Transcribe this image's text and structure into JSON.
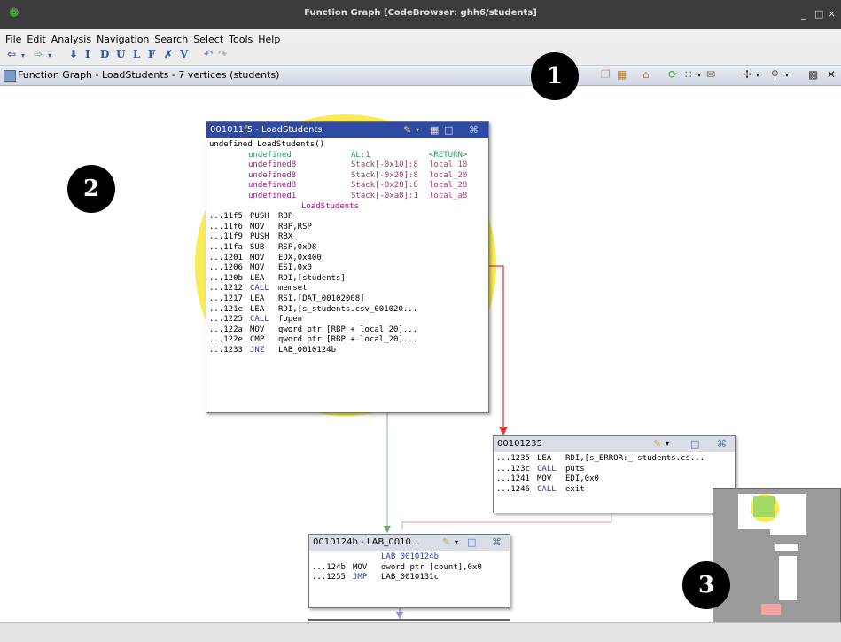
{
  "window": {
    "title": "Function Graph [CodeBrowser: ghh6/students]",
    "minimize": "_",
    "maximize": "□",
    "close": "×"
  },
  "menu": [
    "File",
    "Edit",
    "Analysis",
    "Navigation",
    "Search",
    "Select",
    "Tools",
    "Help"
  ],
  "toolbar_letters": [
    "I",
    "D",
    "U",
    "L",
    "F",
    "V"
  ],
  "provider": {
    "title": "Function Graph - LoadStudents - 7 vertices  (students)"
  },
  "callouts": [
    "1",
    "2",
    "3"
  ],
  "blocks": {
    "load": {
      "header": "001011f5 - LoadStudents",
      "sig": "undefined LoadStudents()",
      "params": [
        {
          "type": "undefined",
          "loc": "AL:1",
          "name": "<RETURN>"
        },
        {
          "type": "undefined8",
          "loc": "Stack[-0x10]:8",
          "name": "local_10"
        },
        {
          "type": "undefined8",
          "loc": "Stack[-0x20]:8",
          "name": "local_20"
        },
        {
          "type": "undefined8",
          "loc": "Stack[-0x28]:8",
          "name": "local_28"
        },
        {
          "type": "undefined1",
          "loc": "Stack[-0xa8]:1",
          "name": "local_a8"
        }
      ],
      "label": "LoadStudents",
      "instr": [
        {
          "addr": "...11f5",
          "op": "PUSH",
          "a": "RBP"
        },
        {
          "addr": "...11f6",
          "op": "MOV",
          "a": "RBP,RSP"
        },
        {
          "addr": "...11f9",
          "op": "PUSH",
          "a": "RBX"
        },
        {
          "addr": "...11fa",
          "op": "SUB",
          "a": "RSP,0x98"
        },
        {
          "addr": "...1201",
          "op": "MOV",
          "a": "EDX,0x400"
        },
        {
          "addr": "...1206",
          "op": "MOV",
          "a": "ESI,0x0"
        },
        {
          "addr": "...120b",
          "op": "LEA",
          "a": "RDI,[students]"
        },
        {
          "addr": "...1212",
          "op": "CALL",
          "a": "memset"
        },
        {
          "addr": "...1217",
          "op": "LEA",
          "a": "RSI,[DAT_00102008]"
        },
        {
          "addr": "...121e",
          "op": "LEA",
          "a": "RDI,[s_students.csv_001020..."
        },
        {
          "addr": "...1225",
          "op": "CALL",
          "a": "fopen"
        },
        {
          "addr": "...122a",
          "op": "MOV",
          "a": "qword ptr [RBP + local_20]..."
        },
        {
          "addr": "...122e",
          "op": "CMP",
          "a": "qword ptr [RBP + local_20]..."
        },
        {
          "addr": "...1233",
          "op": "JNZ",
          "a": "LAB_0010124b"
        }
      ]
    },
    "b235": {
      "header": "00101235",
      "instr": [
        {
          "addr": "...1235",
          "op": "LEA",
          "a": "RDI,[s_ERROR:_'students.cs..."
        },
        {
          "addr": "...123c",
          "op": "CALL",
          "a": "puts"
        },
        {
          "addr": "...1241",
          "op": "MOV",
          "a": "EDI,0x0"
        },
        {
          "addr": "...1246",
          "op": "CALL",
          "a": "exit"
        }
      ]
    },
    "b24b": {
      "header": "0010124b - LAB_0010...",
      "label": "LAB_0010124b",
      "instr": [
        {
          "addr": "...124b",
          "op": "MOV",
          "a": "dword ptr [count],0x0"
        },
        {
          "addr": "...1255",
          "op": "JMP",
          "a": "LAB_0010131c"
        }
      ]
    }
  },
  "colors": {
    "highlight": "#f6e93a",
    "selected_header": "#2f4aa2",
    "block_header": "#d9dde6",
    "edge_true": "#d33",
    "edge_false": "#8bbf8b",
    "edge_uncond": "#9a8fe0"
  }
}
